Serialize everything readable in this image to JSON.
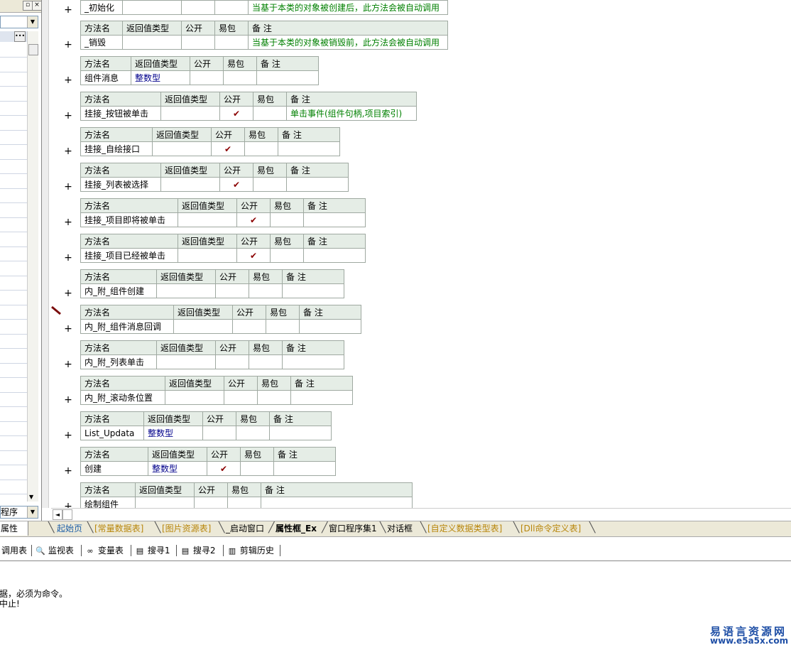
{
  "left_panel": {
    "bottom_tab_label": "属性",
    "bottom_combo_value": "程序"
  },
  "header_row": {
    "name": "方法名",
    "return_type": "返回值类型",
    "public": "公开",
    "easy_pack": "易包",
    "note": "备 注"
  },
  "methods": [
    {
      "name": "_初始化",
      "return_type": "",
      "public": "",
      "note": "当基于本类的对象被创建后，此方法会被自动调用"
    },
    {
      "name": "_销毁",
      "return_type": "",
      "public": "",
      "note": "当基于本类的对象被销毁前，此方法会被自动调用"
    },
    {
      "name": "组件消息",
      "return_type": "整数型",
      "public": "",
      "note": ""
    },
    {
      "name": "挂接_按钮被单击",
      "return_type": "",
      "public": "✔",
      "note": "单击事件(组件句柄,项目索引)"
    },
    {
      "name": "挂接_自绘接口",
      "return_type": "",
      "public": "✔",
      "note": ""
    },
    {
      "name": "挂接_列表被选择",
      "return_type": "",
      "public": "✔",
      "note": ""
    },
    {
      "name": "挂接_项目即将被单击",
      "return_type": "",
      "public": "✔",
      "note": ""
    },
    {
      "name": "挂接_项目已经被单击",
      "return_type": "",
      "public": "✔",
      "note": ""
    },
    {
      "name": "内_附_组件创建",
      "return_type": "",
      "public": "",
      "note": ""
    },
    {
      "name": "内_附_组件消息回调",
      "return_type": "",
      "public": "",
      "note": ""
    },
    {
      "name": "内_附_列表单击",
      "return_type": "",
      "public": "",
      "note": ""
    },
    {
      "name": "内_附_滚动条位置",
      "return_type": "",
      "public": "",
      "note": ""
    },
    {
      "name": "List_Updata",
      "return_type": "整数型",
      "public": "",
      "note": ""
    },
    {
      "name": "创建",
      "return_type": "整数型",
      "public": "✔",
      "note": ""
    },
    {
      "name": "绘制组件",
      "return_type": "",
      "public": "",
      "note": ""
    }
  ],
  "tabs": [
    {
      "label": "起始页"
    },
    {
      "label": "[常量数据表]"
    },
    {
      "label": "[图片资源表]"
    },
    {
      "label": "_启动窗口"
    },
    {
      "label": "属性框_Ex"
    },
    {
      "label": "窗口程序集1"
    },
    {
      "label": "对话框"
    },
    {
      "label": "[自定义数据类型表]"
    },
    {
      "label": "[Dll命令定义表]"
    }
  ],
  "toolbar": [
    {
      "label": "调用表",
      "icon": ""
    },
    {
      "label": "监视表",
      "icon": "magnifier-icon"
    },
    {
      "label": "变量表",
      "icon": "variables-icon"
    },
    {
      "label": "搜寻1",
      "icon": "search-doc-icon"
    },
    {
      "label": "搜寻2",
      "icon": "search-doc-icon"
    },
    {
      "label": "剪辑历史",
      "icon": "clipboard-icon"
    }
  ],
  "output": {
    "line1": "据，必须为命令。",
    "line2": "中止!"
  },
  "watermark": {
    "line1": "易语言资源网",
    "line2": "www.e5a5x.com"
  },
  "colors": {
    "header_bg": "#e5ede6",
    "note_text": "#008000",
    "return_type_text": "#00008b",
    "check": "#8b0000",
    "tab_yellow": "#b8860b",
    "tab_blue": "#1e5fa8",
    "watermark": "#1f4fa6"
  }
}
